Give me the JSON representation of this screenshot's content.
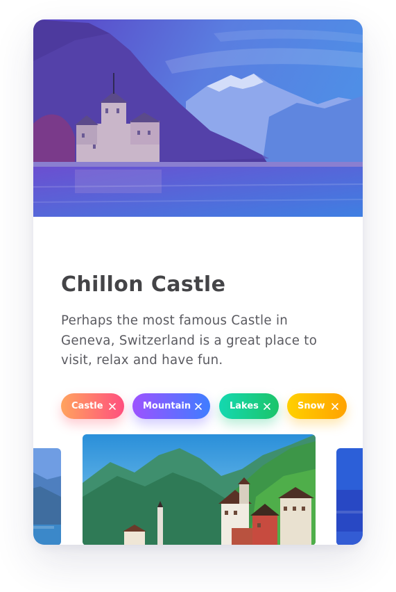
{
  "card": {
    "title": "Chillon Castle",
    "description": "Perhaps the most famous Castle in Geneva, Switzerland is a great place to visit, relax and have fun.",
    "hero_image": "chillon-castle-lake-photo"
  },
  "tags": [
    {
      "label": "Castle",
      "icon": "close-icon",
      "color": "#ff6a6e"
    },
    {
      "label": "Mountain",
      "icon": "close-icon",
      "color": "#6e63ff"
    },
    {
      "label": "Lakes",
      "icon": "close-icon",
      "color": "#19cf8c"
    },
    {
      "label": "Snow",
      "icon": "close-icon",
      "color": "#ffbb00"
    }
  ],
  "carousel": {
    "items": [
      {
        "image": "mountain-lake-photo-partial"
      },
      {
        "image": "hallstatt-village-photo"
      },
      {
        "image": "blue-lake-photo-partial"
      }
    ]
  }
}
